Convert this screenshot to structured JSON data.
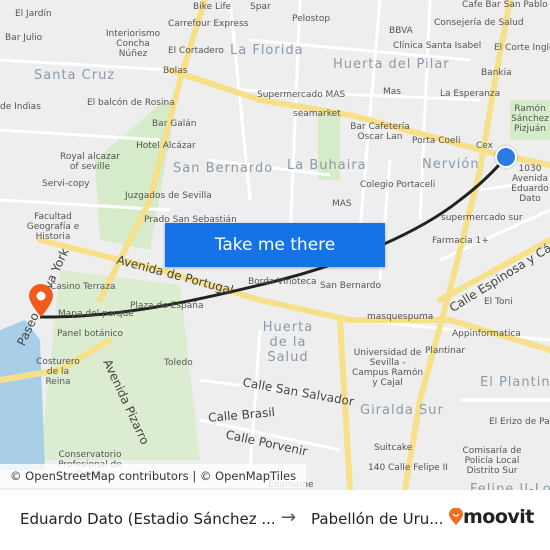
{
  "map": {
    "districts": [
      "Santa Cruz",
      "La Florida",
      "Huerta del Pilar",
      "San Bernardo",
      "La Buhaira",
      "Nervión",
      "Huerta de la Salud",
      "Giralda Sur",
      "El Plantinar",
      "Felipe II-Los Dioses"
    ],
    "roads": [
      "Avenida de Portugal",
      "Calle Espinosa y Cárcel",
      "Calle San Salvador",
      "Calle Brasil",
      "Calle Porvenir",
      "Avenida Pizarro",
      "Paseo Nueva York"
    ],
    "places": [
      "El Jardín",
      "Bar Julio",
      "Bike Life",
      "Spar",
      "Carrefour Express",
      "Interiorismo Concha Núñez",
      "El Cortadero",
      "Bolas",
      "El balcón de Rosina",
      "Bar Galán",
      "Hotel Alcázar",
      "Royal alcazar of seville",
      "Servi-copy",
      "Juzgados de Sevilla",
      "Facultad Geografía e Historia",
      "Prado San Sebastián",
      "de Indias",
      "Pelostop",
      "BBVA",
      "Consejería de Salud",
      "Cafe Bar San Pablo",
      "Clínica Santa Isabel",
      "El Corte Inglés",
      "Bankia",
      "Supermercado MAS",
      "Mas",
      "La Esperanza",
      "seamarket",
      "Bar Cafetería Oscar Lan",
      "Porta Coeli",
      "Cex",
      "Ramón Sánchez Pizjuán",
      "Colegio Portaceli",
      "MAS",
      "supermercado sur",
      "Farmacia 1+",
      "Casino Terraza",
      "Mapa del parque",
      "Panel botánico",
      "Plaza de España",
      "Borda Vinoteca",
      "San Bernardo",
      "Costurero de la Reina",
      "masquespuma",
      "Appinformatica",
      "Universidad de Sevilla - Campus Ramón y Cajal",
      "Plantinar",
      "El Toni",
      "El Erizo de Papel",
      "Suitcake",
      "Comisaría de Policía Local Distrito Sur",
      "140 Calle Felipe II",
      "Toledo",
      "Conservatorio Profesional de Danza",
      "Edamame",
      "1030 Avenida Eduardo Dato"
    ],
    "origin_color": "#2c7be5",
    "destination_color": "#f05a1a",
    "route_color": "#222222"
  },
  "cta": {
    "label": "Take me there"
  },
  "attribution": "© OpenStreetMap contributors | © OpenMapTiles",
  "footer": {
    "from": "Eduardo Dato (Estadio Sánchez ...",
    "to": "Pabellón de Uru...",
    "brand": "moovit",
    "brand_color": "#f26d21"
  }
}
